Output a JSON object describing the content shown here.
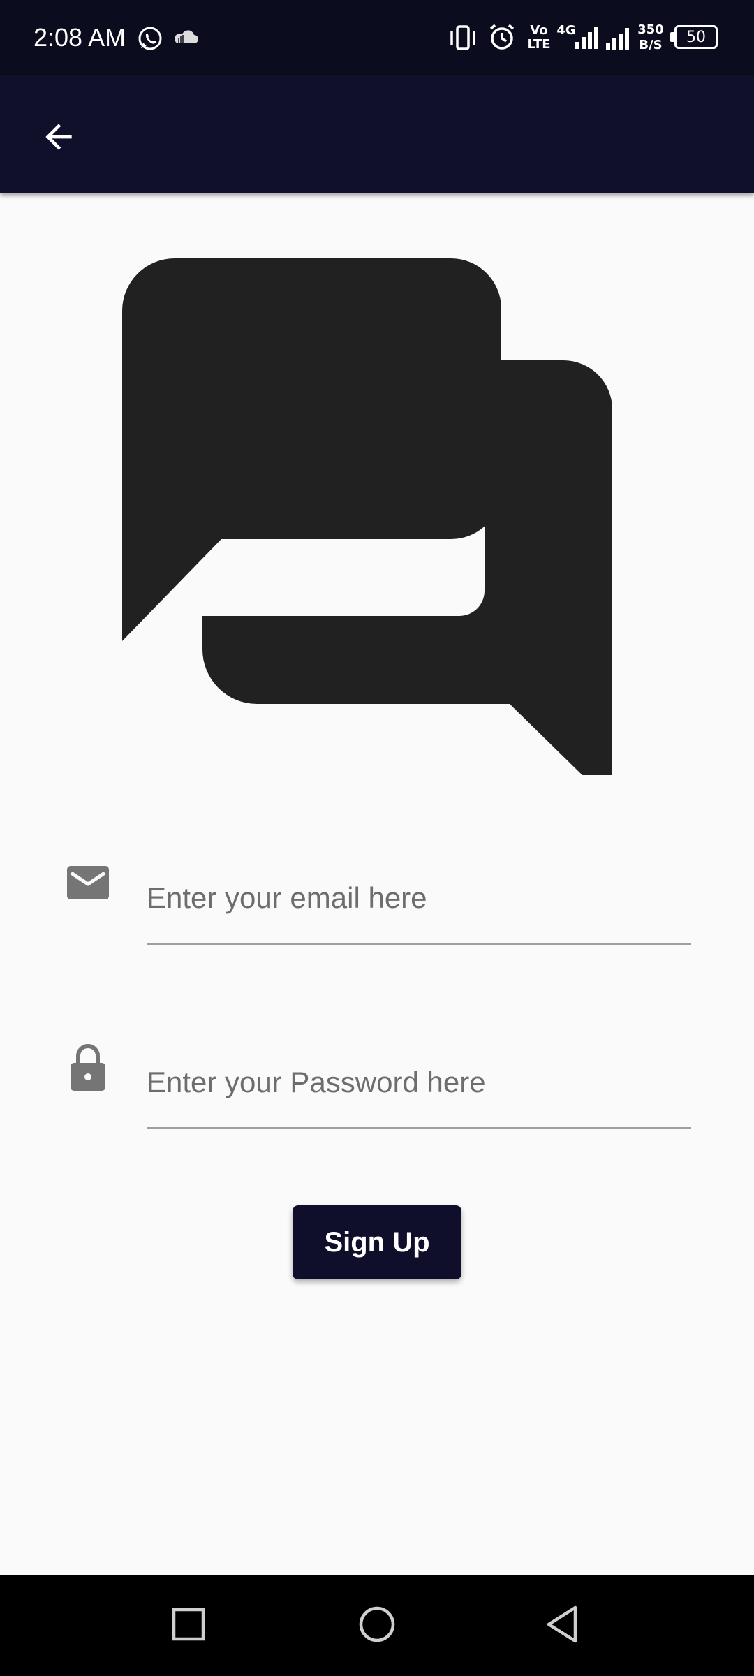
{
  "status_bar": {
    "time": "2:08 AM",
    "net_speed_value": "350",
    "net_speed_unit": "B/S",
    "battery": "50",
    "volte_top": "Vo",
    "volte_bottom": "LTE",
    "network_type": "4G",
    "icons": [
      "whatsapp-icon",
      "cloud-icon",
      "vibrate-icon",
      "alarm-icon",
      "signal-icon",
      "battery-icon"
    ]
  },
  "app_bar": {
    "back_icon": "arrow-back-icon",
    "background": "#10102b"
  },
  "hero": {
    "icon": "chat-bubbles-icon",
    "color": "#212121"
  },
  "form": {
    "email": {
      "icon": "mail-icon",
      "placeholder": "Enter your email here",
      "value": ""
    },
    "password": {
      "icon": "lock-icon",
      "placeholder": "Enter your Password here",
      "value": ""
    },
    "signup_label": "Sign Up"
  },
  "nav_bar": {
    "icons": [
      "recents-square-icon",
      "home-circle-icon",
      "back-triangle-icon"
    ]
  },
  "colors": {
    "primary_dark": "#0f0f2c",
    "background": "#fafafa",
    "icon_grey": "#757575"
  }
}
